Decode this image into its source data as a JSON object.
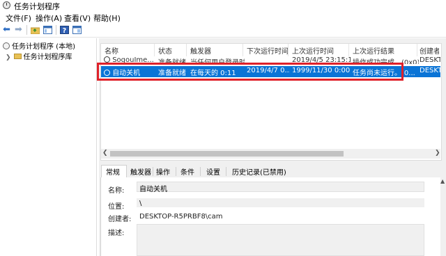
{
  "window": {
    "title": "任务计划程序"
  },
  "menu": [
    "文件(F)",
    "操作(A)",
    "查看(V)",
    "帮助(H)"
  ],
  "tree": {
    "root": "任务计划程序 (本地)",
    "library": "任务计划程序库"
  },
  "task_list": {
    "columns": [
      "名称",
      "状态",
      "触发器",
      "下次运行时间",
      "上次运行时间",
      "上次运行结果",
      "创建者"
    ],
    "rows": [
      [
        "SogouIme...",
        "准备就绪",
        "当任何用户登录时",
        "",
        "2019/4/5 23:15:19",
        "操作成功完成。(0x0)",
        "DESKT"
      ],
      [
        "自动关机",
        "准备就绪",
        "在每天的 0:11",
        "2019/4/7 0...",
        "1999/11/30 0:00...",
        "任务尚未运行。(0...",
        "DESKT"
      ]
    ]
  },
  "tabs": [
    "常规",
    "触发器",
    "操作",
    "条件",
    "设置",
    "历史记录(已禁用)"
  ],
  "general": {
    "name_label": "名称:",
    "name_value": "自动关机",
    "location_label": "位置:",
    "location_value": "\\",
    "author_label": "创建者:",
    "author_value": "DESKTOP-R5PRBF8\\cam",
    "description_label": "描述:"
  },
  "colors": {
    "selection": "#0a74d6",
    "highlight_box": "#e0212a"
  }
}
